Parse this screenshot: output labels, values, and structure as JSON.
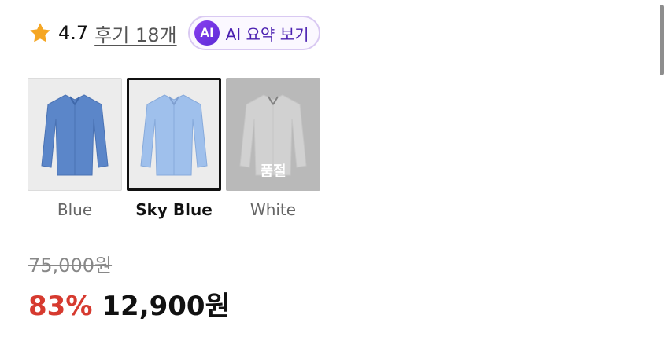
{
  "rating": {
    "value": "4.7",
    "review_link": "후기 18개",
    "star_color": "#f5a623"
  },
  "ai_summary": {
    "badge": "AI",
    "label": "AI 요약 보기",
    "accent_color": "#6b2fe0"
  },
  "variants": [
    {
      "name": "Blue",
      "selected": false,
      "sold_out": false,
      "color": "#5b86c9"
    },
    {
      "name": "Sky Blue",
      "selected": true,
      "sold_out": false,
      "color": "#9fc0ec"
    },
    {
      "name": "White",
      "selected": false,
      "sold_out": true,
      "sold_out_label": "품절",
      "color": "#e6e6e6"
    }
  ],
  "price": {
    "original": "75,000원",
    "discount": "83%",
    "sale": "12,900원",
    "discount_color": "#d63a2f"
  }
}
